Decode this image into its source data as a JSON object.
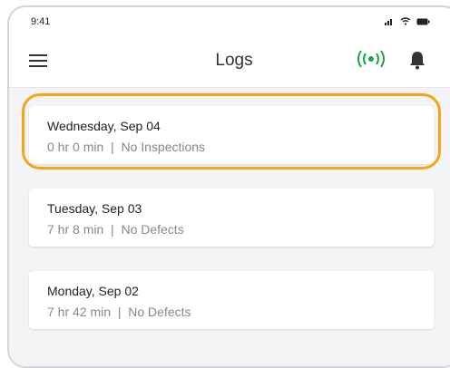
{
  "status_bar": {
    "time": "9:41"
  },
  "app_bar": {
    "title": "Logs"
  },
  "logs": [
    {
      "date": "Wednesday, Sep 04",
      "duration": "0 hr 0 min",
      "status": "No Inspections",
      "highlighted": true
    },
    {
      "date": "Tuesday, Sep 03",
      "duration": "7 hr 8 min",
      "status": "No Defects",
      "highlighted": false
    },
    {
      "date": "Monday, Sep 02",
      "duration": "7 hr 42 min",
      "status": "No Defects",
      "highlighted": false
    }
  ],
  "colors": {
    "highlight": "#f5a614",
    "connected": "#1aa34a",
    "background": "#f3f4f6"
  },
  "icons": {
    "menu": "hamburger-icon",
    "connection": "broadcast-icon",
    "notifications": "bell-icon"
  }
}
